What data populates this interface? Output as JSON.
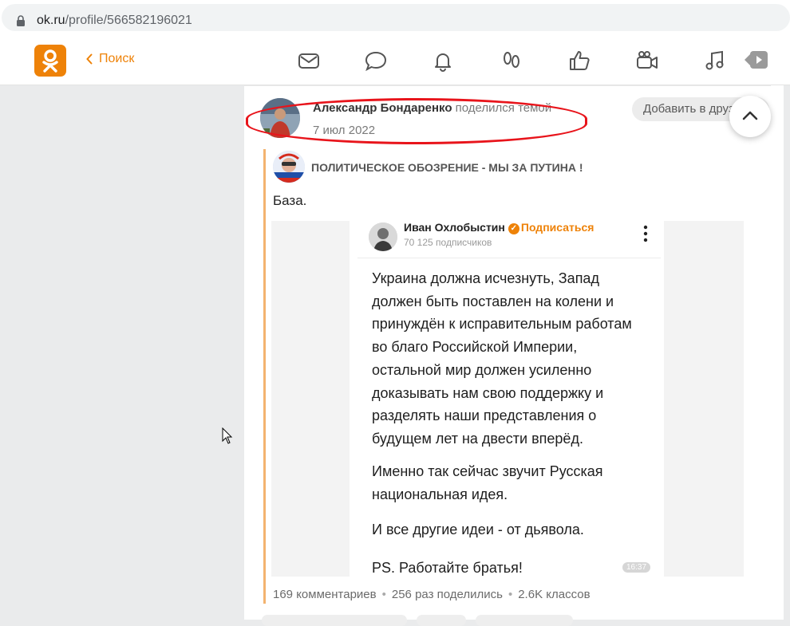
{
  "browser": {
    "url_host": "ok.ru",
    "url_path": "/profile/566582196021"
  },
  "header": {
    "back_label": "Поиск",
    "nav_icons": [
      "mail-icon",
      "chat-icon",
      "bell-icon",
      "guests-icon",
      "like-icon",
      "camera-icon",
      "music-icon",
      "video-icon"
    ]
  },
  "post": {
    "author": "Александр Бондаренко",
    "action": "поделился темой",
    "date": "7 июл 2022",
    "add_friend": "Добавить в друзья",
    "group_name": "ПОЛИТИЧЕСКОЕ ОБОЗРЕНИЕ - МЫ ЗА ПУТИНА !",
    "text": "База.",
    "image": {
      "name": "Иван Охлобыстин",
      "subscribe": "Подписаться",
      "subscribers": "70 125 подписчиков",
      "p1": "Украина должна исчезнуть, Запад\nдолжен быть поставлен на колени и\nпринуждён к исправительным работам\nво благо Российской Империи,\nостальной мир должен усиленно\nдоказывать нам свою поддержку и\nразделять наши представления о\nбудущем лет на двести вперёд.",
      "p2": "Именно так сейчас звучит Русская\nнациональная идея.",
      "p3": "И все другие идеи - от дьявола.",
      "p4": "PS. Работайте братья!",
      "time": "16:37"
    },
    "stats": {
      "comments": "169 комментариев",
      "shares": "256 раз поделились",
      "likes": "2.6K классов"
    }
  },
  "colors": {
    "brand": "#ee8208",
    "highlight": "#e8141b",
    "quote_line": "#f3b36f"
  }
}
